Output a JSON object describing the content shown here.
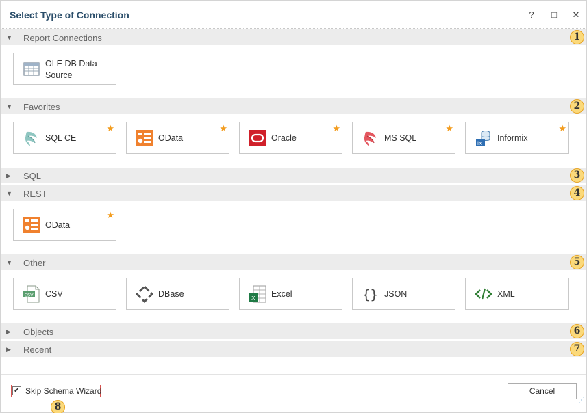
{
  "window": {
    "title": "Select Type of Connection",
    "help_glyph": "?",
    "maximize_glyph": "□",
    "close_glyph": "✕"
  },
  "sections": [
    {
      "label": "Report Connections",
      "expanded": true,
      "badge": "1"
    },
    {
      "label": "Favorites",
      "expanded": true,
      "badge": "2"
    },
    {
      "label": "SQL",
      "expanded": false,
      "badge": "3"
    },
    {
      "label": "REST",
      "expanded": true,
      "badge": "4"
    },
    {
      "label": "Other",
      "expanded": true,
      "badge": "5"
    },
    {
      "label": "Objects",
      "expanded": false,
      "badge": "6"
    },
    {
      "label": "Recent",
      "expanded": false,
      "badge": "7"
    }
  ],
  "report_connections": [
    {
      "label": "OLE DB Data Source",
      "icon": "table-icon",
      "favorite": false
    }
  ],
  "favorites": [
    {
      "label": "SQL CE",
      "icon": "sql-server-icon",
      "favorite": true
    },
    {
      "label": "OData",
      "icon": "odata-icon",
      "favorite": true
    },
    {
      "label": "Oracle",
      "icon": "oracle-icon",
      "favorite": true
    },
    {
      "label": "MS SQL",
      "icon": "sql-server-icon",
      "favorite": true
    },
    {
      "label": "Informix",
      "icon": "informix-icon",
      "favorite": true
    }
  ],
  "rest": [
    {
      "label": "OData",
      "icon": "odata-icon",
      "favorite": true
    }
  ],
  "other": [
    {
      "label": "CSV",
      "icon": "csv-icon",
      "favorite": false
    },
    {
      "label": "DBase",
      "icon": "dbase-icon",
      "favorite": false
    },
    {
      "label": "Excel",
      "icon": "excel-icon",
      "favorite": false
    },
    {
      "label": "JSON",
      "icon": "json-icon",
      "favorite": false
    },
    {
      "label": "XML",
      "icon": "xml-icon",
      "favorite": false
    }
  ],
  "footer": {
    "skip_schema_label": "Skip Schema Wizard",
    "skip_schema_checked": true,
    "check_glyph": "✔",
    "badge": "8",
    "cancel_label": "Cancel"
  },
  "colors": {
    "title": "#2b4e6a",
    "star": "#f39c1e",
    "badge_fill": "#fbd97a",
    "odata": "#f0812e",
    "oracle": "#d0202a",
    "excel": "#1f7a45",
    "xml": "#2e7d32"
  }
}
